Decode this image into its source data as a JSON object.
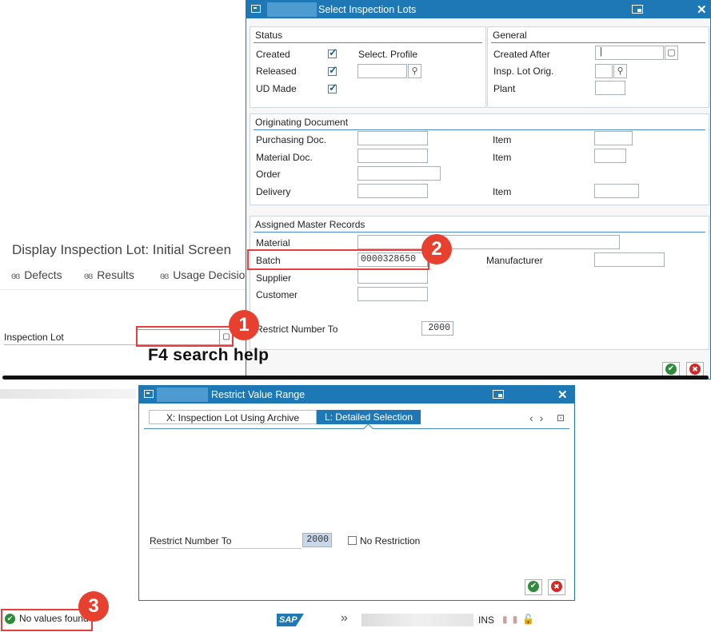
{
  "background_screen": {
    "title": "Display Inspection Lot: Initial Screen",
    "toolbar": [
      {
        "label": "Defects",
        "icon": "glasses-icon"
      },
      {
        "label": "Results",
        "icon": "glasses-icon"
      },
      {
        "label": "Usage Decisio",
        "icon": "glasses-icon"
      }
    ],
    "inspection_lot_label": "Inspection Lot",
    "inspection_lot_value": ""
  },
  "select_dialog": {
    "title": "Select Inspection Lots",
    "status": {
      "title": "Status",
      "created": "Created",
      "released": "Released",
      "ud_made": "UD Made",
      "select_profile": "Select. Profile",
      "created_checked": true,
      "released_checked": true,
      "ud_made_checked": true
    },
    "general": {
      "title": "General",
      "created_after": "Created After",
      "insp_lot_orig": "Insp. Lot Orig.",
      "plant": "Plant"
    },
    "originating": {
      "title": "Originating Document",
      "purchasing_doc": "Purchasing Doc.",
      "material_doc": "Material Doc.",
      "order": "Order",
      "delivery": "Delivery",
      "item": "Item"
    },
    "assigned": {
      "title": "Assigned Master Records",
      "material": "Material",
      "batch": "Batch",
      "batch_value": "0000328650",
      "manufacturer": "Manufacturer",
      "supplier": "Supplier",
      "customer": "Customer",
      "restrict_number_to": "Restrict Number To",
      "restrict_value": "2000"
    }
  },
  "restrict_dialog": {
    "title": "Restrict Value Range",
    "tabs": [
      {
        "label": "X: Inspection Lot Using Archive",
        "active": false
      },
      {
        "label": "L: Detailed Selection",
        "active": true
      }
    ],
    "restrict_number_to": "Restrict Number To",
    "restrict_value": "2000",
    "no_restriction": "No Restriction"
  },
  "status_bar": {
    "message": "No values found",
    "logo": "SAP",
    "mode": "INS"
  },
  "annotations": {
    "badge1": "1",
    "badge2": "2",
    "badge3": "3",
    "f4_text": "F4 search help"
  },
  "colors": {
    "sap_blue": "#1f78b6",
    "annotation_red": "#e83e3e"
  }
}
